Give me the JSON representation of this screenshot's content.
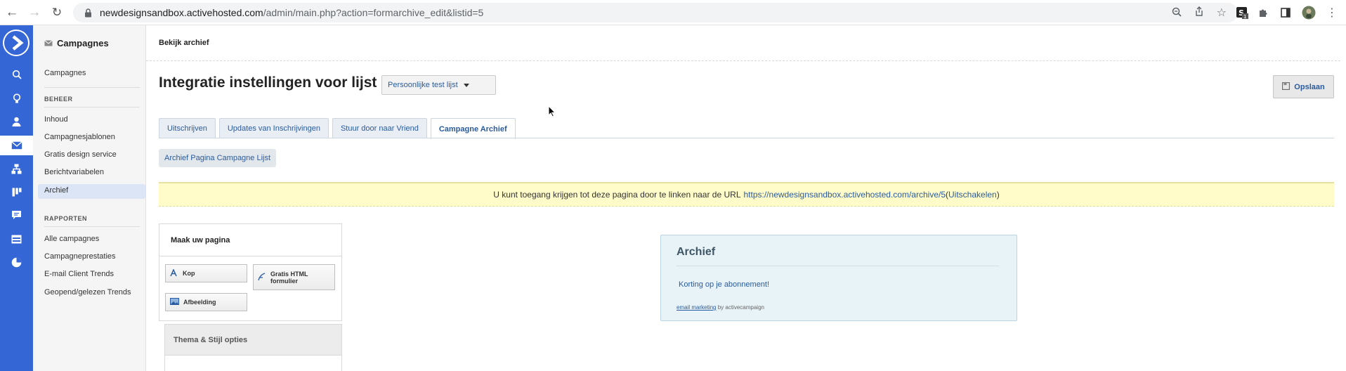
{
  "browser": {
    "url_host": "newdesignsandbox.activehosted.com",
    "url_path": "/admin/main.php?action=formarchive_edit&listid=5"
  },
  "sidebar": {
    "title": "Campagnes",
    "top_link": "Campagnes",
    "section_beheer": "BEHEER",
    "beheer_items": [
      "Inhoud",
      "Campagnesjablonen",
      "Gratis design service",
      "Berichtvariabelen",
      "Archief"
    ],
    "section_rapporten": "RAPPORTEN",
    "rapporten_items": [
      "Alle campagnes",
      "Campagneprestaties",
      "E-mail Client Trends",
      "Geopend/gelezen Trends"
    ],
    "active_item": "Archief"
  },
  "header": {
    "breadcrumb": "Bekijk archief",
    "title": "Integratie instellingen voor lijst",
    "list_select_value": "Persoonlijke test lijst",
    "save_label": "Opslaan"
  },
  "tabs": {
    "items": [
      "Uitschrijven",
      "Updates van Inschrijvingen",
      "Stuur door naar Vriend",
      "Campagne Archief"
    ],
    "active": "Campagne Archief",
    "subtab": "Archief Pagina Campagne Lijst"
  },
  "notice": {
    "text": "U kunt toegang krijgen tot deze pagina door te linken naar de URL",
    "url": "https://newdesignsandbox.activehosted.com/archive/5",
    "open_paren": "(",
    "disable_link": "Uitschakelen",
    "close_paren": ")"
  },
  "builder": {
    "heading": "Maak uw pagina",
    "widgets": [
      "Kop",
      "Gratis HTML formulier",
      "Afbeelding"
    ],
    "theme_heading": "Thema & Stijl opties"
  },
  "preview": {
    "title": "Archief",
    "item": "Korting op je abonnement!",
    "footer_link": "email marketing",
    "footer_text": "by activecampaign"
  },
  "colors": {
    "nav_blue": "#3566d6",
    "link_blue": "#2a5b9e",
    "notice_yellow": "#fffcc9",
    "preview_bg": "#e8f3f8"
  }
}
